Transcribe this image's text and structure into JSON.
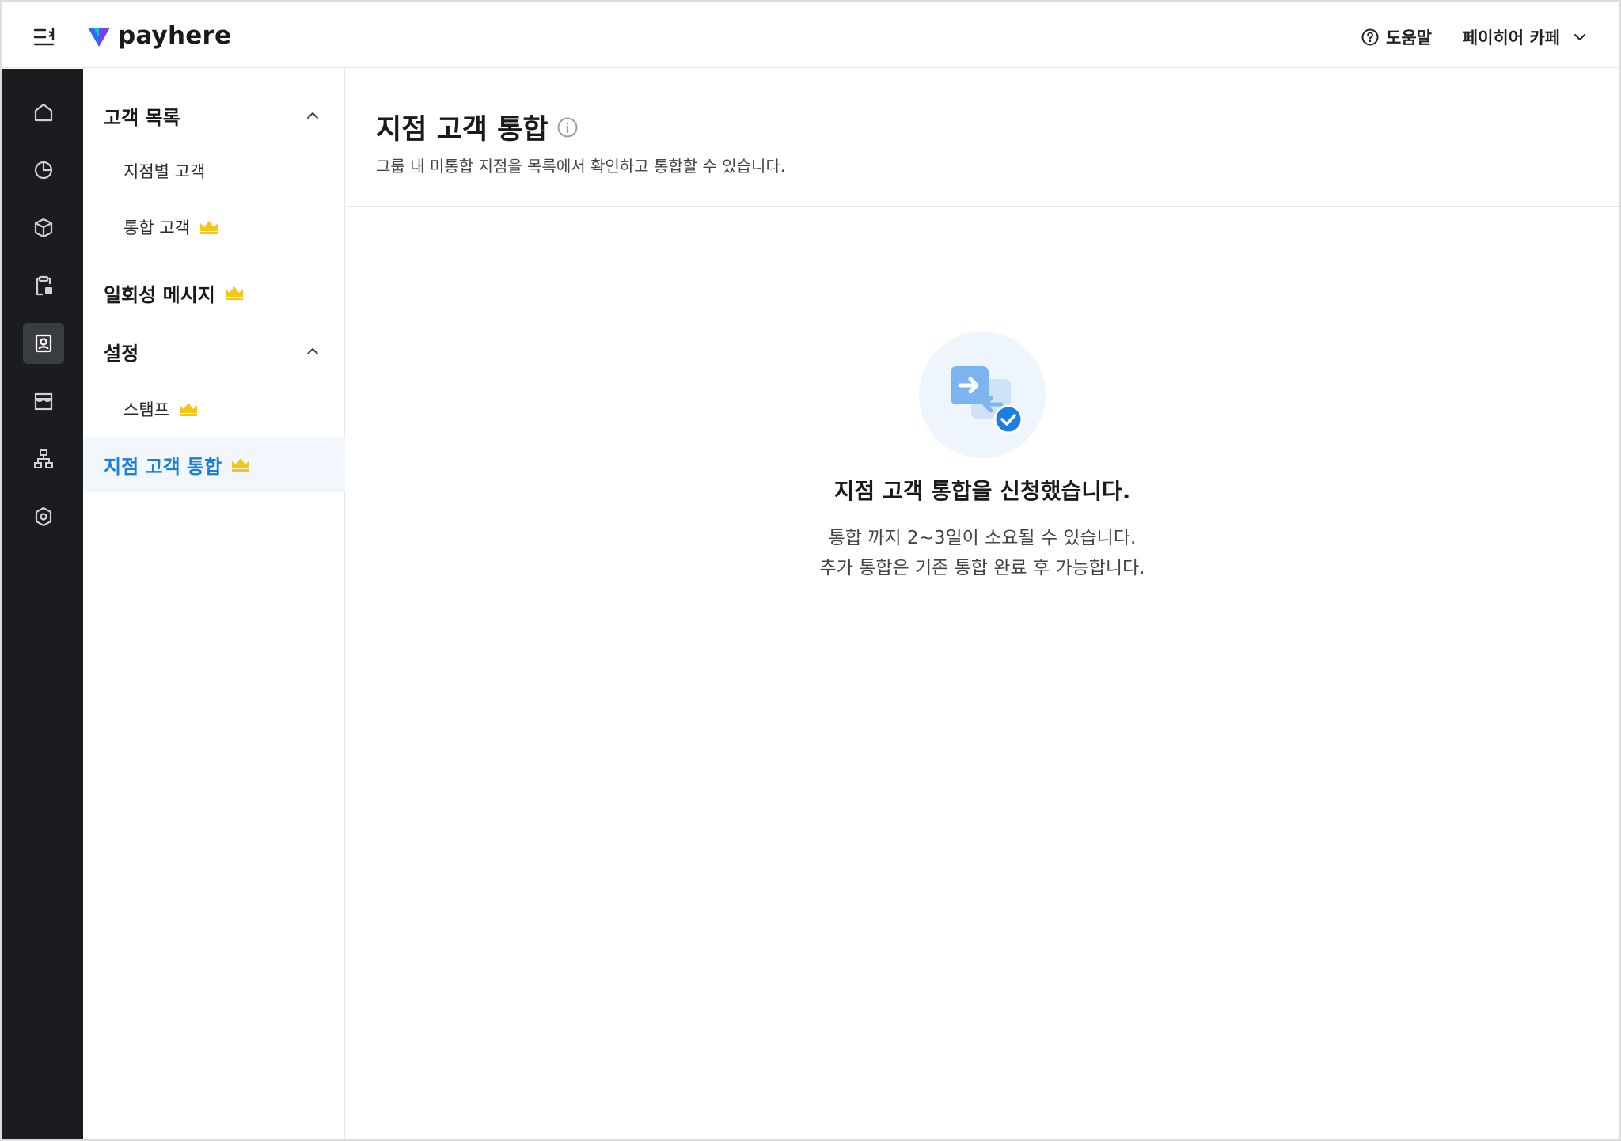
{
  "header": {
    "brand": "payhere",
    "help_label": "도움말",
    "store_name": "페이히어 카페"
  },
  "rail": {
    "items": [
      {
        "icon": "home-icon"
      },
      {
        "icon": "pie-chart-icon"
      },
      {
        "icon": "box-icon"
      },
      {
        "icon": "clipboard-icon"
      },
      {
        "icon": "customer-icon",
        "active": true
      },
      {
        "icon": "store-icon"
      },
      {
        "icon": "org-chart-icon"
      },
      {
        "icon": "settings-icon"
      }
    ]
  },
  "subnav": {
    "customer_list": "고객 목록",
    "by_branch": "지점별 고객",
    "integrated": "통합 고객",
    "one_time_message": "일회성 메시지",
    "settings": "설정",
    "stamp": "스탬프",
    "branch_integration": "지점 고객 통합"
  },
  "page": {
    "title": "지점 고객 통합",
    "description": "그룹 내 미통합 지점을 목록에서 확인하고 통합할 수 있습니다."
  },
  "empty_state": {
    "title": "지점 고객 통합을 신청했습니다.",
    "line1": "통합 까지 2~3일이 소요될 수 있습니다.",
    "line2": "추가 통합은 기존 통합 완료 후 가능합니다."
  },
  "colors": {
    "accent": "#1a7fe0",
    "rail_bg": "#1b1c20",
    "crown": "#f5c518"
  }
}
